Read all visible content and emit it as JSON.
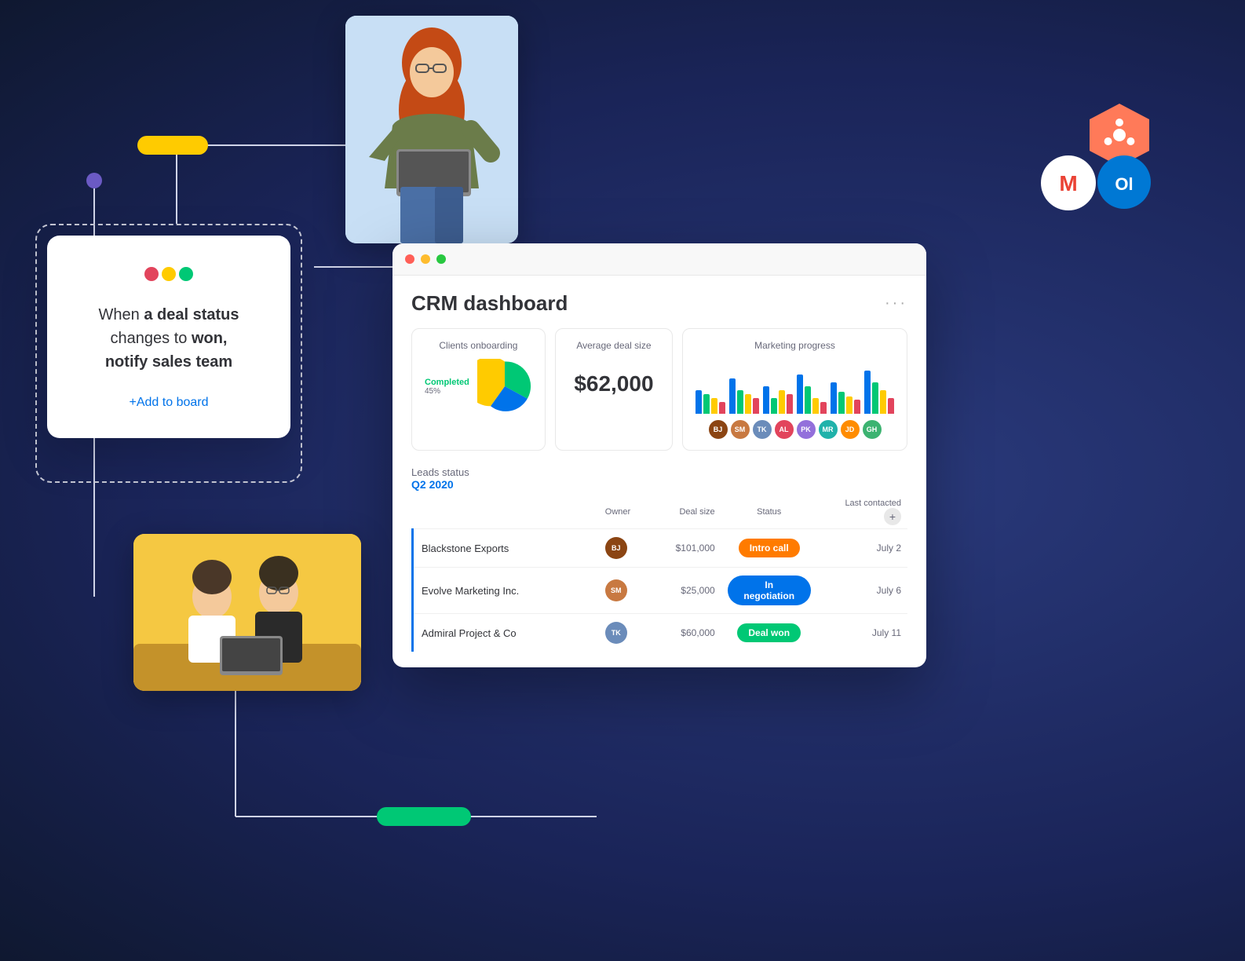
{
  "background": {
    "color": "#1e2a5e"
  },
  "automation_card": {
    "logo_dots": [
      "#e2445c",
      "#ffcb00",
      "#00c875"
    ],
    "text_plain": "When ",
    "text_bold1": "a deal status",
    "text_middle": " changes to ",
    "text_bold2": "won,",
    "text_end": "notify sales team",
    "cta": "+Add to board"
  },
  "crm_dashboard": {
    "title": "CRM dashboard",
    "dots_label": "···",
    "stats": {
      "clients_onboarding": {
        "label": "Clients onboarding",
        "legend_completed": "Completed",
        "legend_percent": "45%",
        "pie_segments": [
          {
            "color": "#00c875",
            "percent": 45
          },
          {
            "color": "#0073ea",
            "percent": 20
          },
          {
            "color": "#ffcb00",
            "percent": 35
          }
        ]
      },
      "average_deal_size": {
        "label": "Average deal size",
        "value": "$62,000"
      },
      "marketing_progress": {
        "label": "Marketing progress",
        "bars": [
          {
            "colors": [
              "#0073ea",
              "#00c875",
              "#ffcb00",
              "#e2445c"
            ],
            "heights": [
              30,
              25,
              20,
              15
            ]
          },
          {
            "colors": [
              "#0073ea",
              "#00c875",
              "#ffcb00",
              "#e2445c"
            ],
            "heights": [
              45,
              30,
              25,
              20
            ]
          },
          {
            "colors": [
              "#0073ea",
              "#00c875",
              "#ffcb00",
              "#e2445c"
            ],
            "heights": [
              35,
              20,
              30,
              25
            ]
          },
          {
            "colors": [
              "#0073ea",
              "#00c875",
              "#ffcb00",
              "#e2445c"
            ],
            "heights": [
              50,
              35,
              20,
              15
            ]
          },
          {
            "colors": [
              "#0073ea",
              "#00c875",
              "#ffcb00",
              "#e2445c"
            ],
            "heights": [
              40,
              28,
              22,
              18
            ]
          },
          {
            "colors": [
              "#0073ea",
              "#00c875",
              "#ffcb00",
              "#e2445c"
            ],
            "heights": [
              55,
              40,
              30,
              20
            ]
          }
        ]
      }
    },
    "leads": {
      "title": "Leads status",
      "period": "Q2 2020",
      "columns": {
        "owner": "Owner",
        "deal_size": "Deal size",
        "status": "Status",
        "last_contacted": "Last contacted"
      },
      "rows": [
        {
          "company": "Blackstone Exports",
          "deal_size": "$101,000",
          "status": "Intro call",
          "status_color": "orange",
          "last_contacted": "July 2",
          "owner_initials": "BJ",
          "owner_color": "#8b4513"
        },
        {
          "company": "Evolve Marketing Inc.",
          "deal_size": "$25,000",
          "status": "In negotiation",
          "status_color": "blue",
          "last_contacted": "July 6",
          "owner_initials": "SM",
          "owner_color": "#c87941"
        },
        {
          "company": "Admiral Project & Co",
          "deal_size": "$60,000",
          "status": "Deal won",
          "status_color": "green",
          "last_contacted": "July 11",
          "owner_initials": "TK",
          "owner_color": "#6b8cba"
        }
      ]
    }
  },
  "integrations": {
    "hubspot_label": "HubSpot",
    "gmail_label": "Gmail",
    "outlook_label": "Outlook"
  },
  "connector_nodes": {
    "yellow_pill_color": "#ffcb00",
    "purple_dot_color": "#6b5ac4",
    "green_dot_color": "#00c875",
    "green_pill_color": "#00c875"
  }
}
